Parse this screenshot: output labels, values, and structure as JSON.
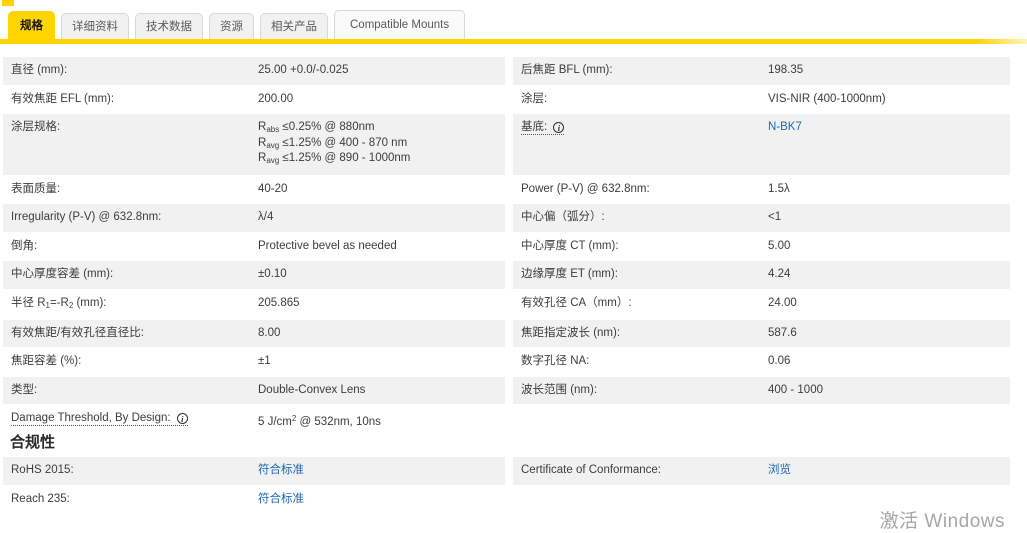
{
  "accent_yellow": "#ffd400",
  "link_blue": "#1e66b0",
  "row_stripe_gray": "#f1f1f1",
  "tabs": [
    {
      "key": "specs",
      "label": "规格",
      "active": true
    },
    {
      "key": "details",
      "label": "详细资料"
    },
    {
      "key": "tech-data",
      "label": "技术数据"
    },
    {
      "key": "resources",
      "label": "资源"
    },
    {
      "key": "related-products",
      "label": "相关产品"
    },
    {
      "key": "compatible-mounts",
      "label": "Compatible Mounts",
      "wide": true
    }
  ],
  "spec_rows": [
    {
      "left": {
        "label": "直径 (mm):",
        "value": "25.00 +0.0/-0.025"
      },
      "right": {
        "label": "后焦距 BFL (mm):",
        "value": "198.35"
      }
    },
    {
      "left": {
        "label": "有效焦距 EFL (mm):",
        "value": "200.00"
      },
      "right": {
        "label": "涂层:",
        "value": "VIS-NIR (400-1000nm)"
      }
    },
    {
      "left": {
        "label": "涂层规格:",
        "value_lines": [
          "R~abs~ ≤0.25% @ 880nm",
          "R~avg~ ≤1.25% @ 400 - 870 nm",
          "R~avg~ ≤1.25% @ 890 - 1000nm"
        ]
      },
      "right": {
        "label": "基底: ",
        "info": true,
        "dotted": true,
        "value": "N-BK7",
        "link": true,
        "link_name": "substrate-material-link"
      }
    },
    {
      "left": {
        "label": "表面质量:",
        "value": "40-20"
      },
      "right": {
        "label": "Power (P-V) @ 632.8nm:",
        "value": "1.5λ"
      }
    },
    {
      "left": {
        "label": "Irregularity (P-V) @ 632.8nm:",
        "value": "λ/4"
      },
      "right": {
        "label": "中心偏（弧分）:",
        "value": "<1"
      }
    },
    {
      "left": {
        "label": "倒角:",
        "value": "Protective bevel as needed"
      },
      "right": {
        "label": "中心厚度 CT (mm):",
        "value": "5.00"
      }
    },
    {
      "left": {
        "label": "中心厚度容差 (mm):",
        "value": "±0.10"
      },
      "right": {
        "label": "边缘厚度 ET (mm):",
        "value": "4.24"
      }
    },
    {
      "left": {
        "label": "半径 R~1~=-R~2~ (mm):",
        "value": "205.865"
      },
      "right": {
        "label": "有效孔径 CA（mm）:",
        "value": "24.00"
      }
    },
    {
      "left": {
        "label": "有效焦距/有效孔径直径比:",
        "value": "8.00"
      },
      "right": {
        "label": "焦距指定波长 (nm):",
        "value": "587.6"
      }
    },
    {
      "left": {
        "label": "焦距容差 (%):",
        "value": "±1"
      },
      "right": {
        "label": "数字孔径 NA:",
        "value": "0.06"
      }
    },
    {
      "left": {
        "label": "类型:",
        "value": "Double-Convex Lens"
      },
      "right": {
        "label": "波长范围 (nm):",
        "value": "400 - 1000"
      }
    },
    {
      "left": {
        "label": "Damage Threshold, By Design: ",
        "info": true,
        "dotted": true,
        "value": "5 J/cm^2^ @ 532nm, 10ns"
      },
      "right": null
    }
  ],
  "compliance": {
    "heading": "合规性",
    "rows": [
      {
        "left": {
          "label": "RoHS 2015:",
          "value": "符合标准",
          "link": true,
          "link_name": "rohs-compliance-link"
        },
        "right": {
          "label": "Certificate of Conformance:",
          "value": "浏览",
          "link": true,
          "link_name": "certificate-browse-link"
        }
      },
      {
        "left": {
          "label": "Reach 235:",
          "value": "符合标准",
          "link": true,
          "link_name": "reach-compliance-link"
        },
        "right": null
      }
    ]
  },
  "watermark": "激活 Windows"
}
